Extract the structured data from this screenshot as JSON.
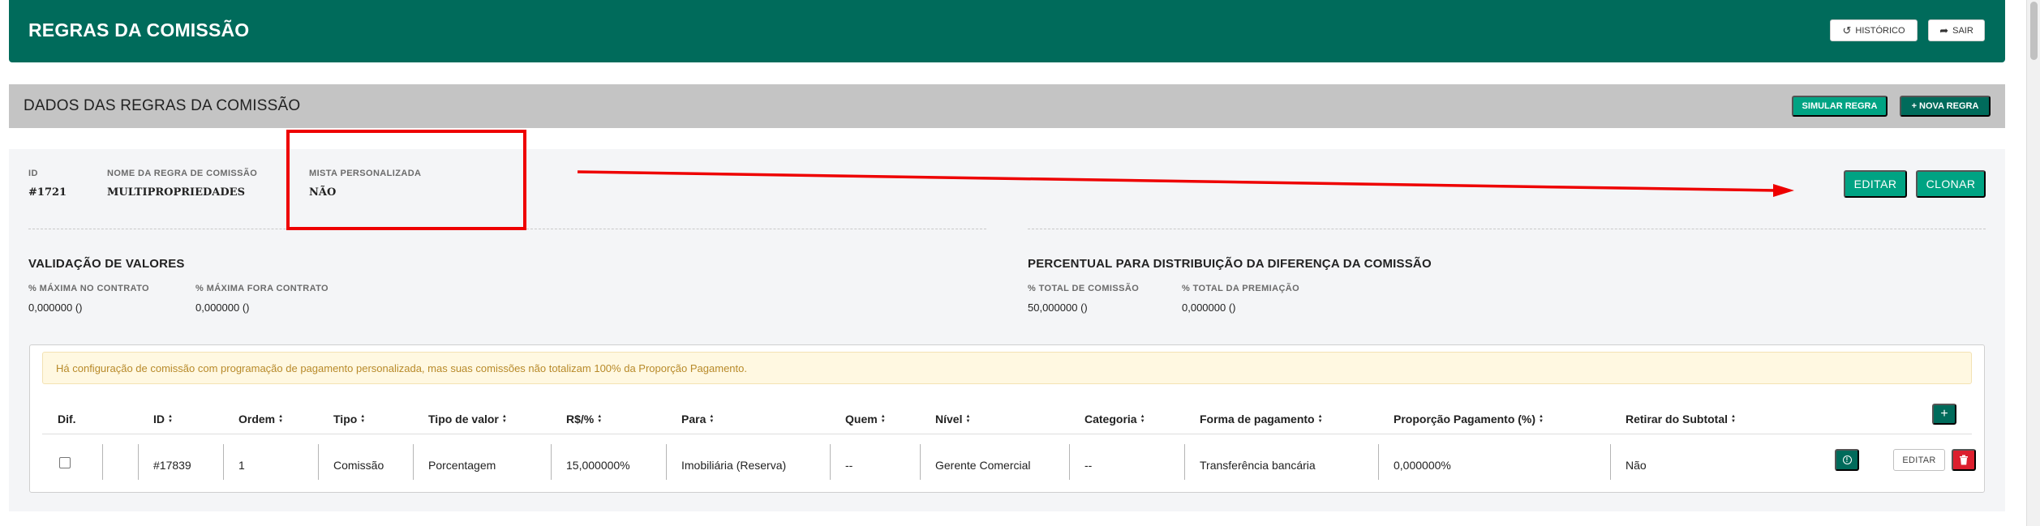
{
  "header": {
    "title": "REGRAS DA COMISSÃO",
    "history_label": "HISTÓRICO",
    "exit_label": "SAIR",
    "accent": "#006b5b"
  },
  "section": {
    "title": "DADOS DAS REGRAS DA COMISSÃO",
    "simulate_label": "SIMULAR REGRA",
    "new_rule_label": "+ NOVA REGRA"
  },
  "details": {
    "id_label": "ID",
    "id_value": "#1721",
    "name_label": "NOME DA REGRA DE COMISSÃO",
    "name_value": "MULTIPROPRIEDADES",
    "mixed_label": "MISTA PERSONALIZADA",
    "mixed_value": "NÃO",
    "edit_label": "EDITAR",
    "clone_label": "CLONAR"
  },
  "validation": {
    "title": "VALIDAÇÃO DE VALORES",
    "max_contract_label": "% MÁXIMA NO CONTRATO",
    "max_contract_value": "0,000000 ()",
    "max_outside_label": "% MÁXIMA FORA CONTRATO",
    "max_outside_value": "0,000000 ()"
  },
  "distribution": {
    "title": "PERCENTUAL PARA DISTRIBUIÇÃO DA DIFERENÇA DA COMISSÃO",
    "total_commission_label": "% TOTAL DE COMISSÃO",
    "total_commission_value": "50,000000 ()",
    "total_award_label": "% TOTAL DA PREMIAÇÃO",
    "total_award_value": "0,000000 ()"
  },
  "alert": {
    "text": "Há configuração de comissão com programação de pagamento personalizada, mas suas comissões não totalizam 100% da Proporção Pagamento."
  },
  "table": {
    "columns": [
      "Dif.",
      "ID",
      "Ordem",
      "Tipo",
      "Tipo de valor",
      "R$/%",
      "Para",
      "Quem",
      "Nível",
      "Categoria",
      "Forma de pagamento",
      "Proporção Pagamento (%)",
      "Retirar do Subtotal"
    ],
    "add_label": "+",
    "row_edit_label": "EDITAR",
    "rows": [
      {
        "id": "#17839",
        "ordem": "1",
        "tipo": "Comissão",
        "tipo_valor": "Porcentagem",
        "valor": "15,000000%",
        "para": "Imobiliária (Reserva)",
        "quem": "--",
        "nivel": "Gerente Comercial",
        "categoria": "--",
        "forma_pagamento": "Transferência bancária",
        "proporcao": "0,000000%",
        "retirar": "Não"
      }
    ]
  }
}
